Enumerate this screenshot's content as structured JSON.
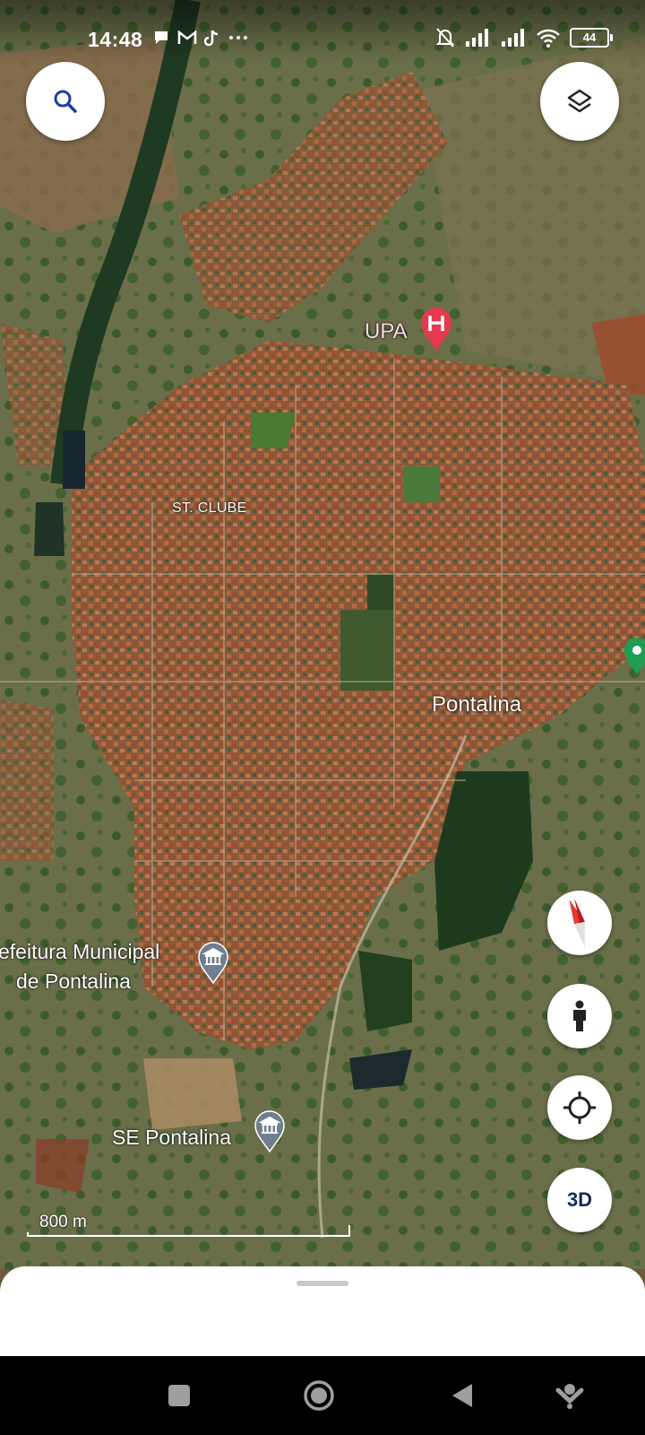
{
  "status_bar": {
    "time": "14:48",
    "left_icons": [
      "chat-icon",
      "gmail-icon",
      "tiktok-icon",
      "more-dots-icon"
    ],
    "right_icons": [
      "mute-icon",
      "signal-icon",
      "signal-icon",
      "wifi-icon"
    ],
    "battery": "44"
  },
  "map": {
    "labels": {
      "upa": "UPA",
      "st_clube": "ST. CLUBE",
      "pontalina": "Pontalina",
      "prefeitura_line1": "efeitura Municipal",
      "prefeitura_line2": "de Pontalina",
      "se_pontalina": "SE Pontalina"
    },
    "scale": "800 m",
    "colors": {
      "hospital_pin": "#e53950",
      "government_pin": "#6f7f8f",
      "place_pin": "#1e9e52"
    }
  },
  "controls": {
    "search_icon": "search-icon",
    "layers_icon": "layers-icon",
    "compass_icon": "compass-icon",
    "street_view_icon": "pegman-icon",
    "location_icon": "my-location-icon",
    "three_d_label": "3D"
  },
  "nav_bar": [
    "recents-square-icon",
    "home-circle-icon",
    "back-triangle-icon",
    "assistant-icon"
  ]
}
